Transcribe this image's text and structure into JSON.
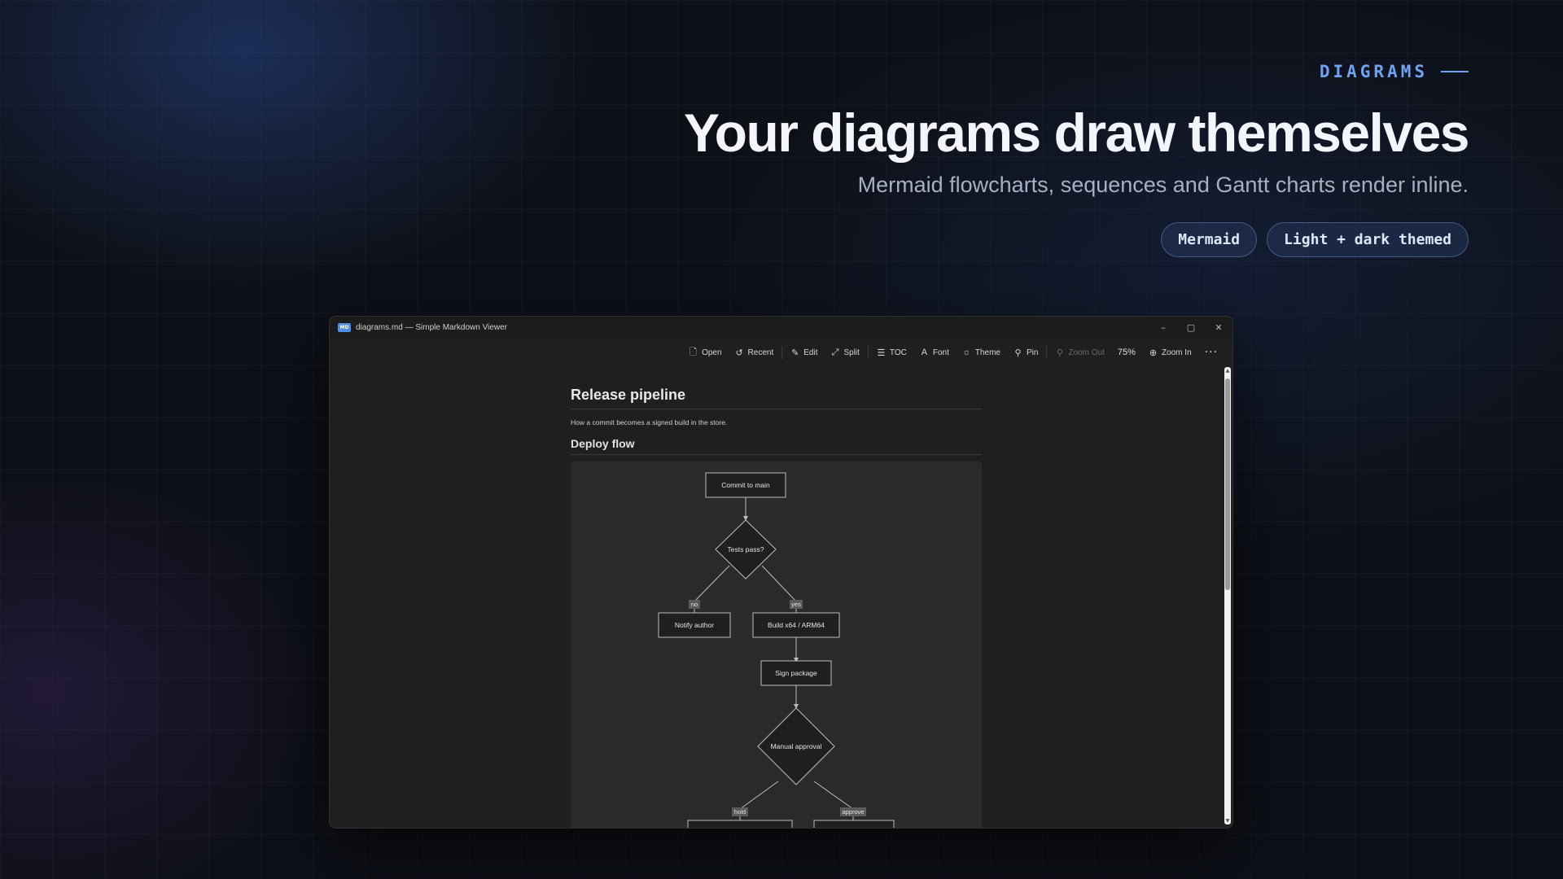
{
  "hero": {
    "eyebrow": "DIAGRAMS",
    "headline": "Your diagrams draw themselves",
    "subline": "Mermaid flowcharts, sequences and Gantt charts render inline.",
    "chips": [
      "Mermaid",
      "Light + dark themed"
    ]
  },
  "window": {
    "icon_label": "MD",
    "title": "diagrams.md — Simple Markdown Viewer",
    "controls": {
      "minimize": "–",
      "maximize": "▢",
      "close": "✕"
    }
  },
  "toolbar": {
    "open": "Open",
    "recent": "Recent",
    "edit": "Edit",
    "split": "Split",
    "toc": "TOC",
    "font": "Font",
    "theme": "Theme",
    "pin": "Pin",
    "zoom_out": "Zoom Out",
    "zoom_level": "75%",
    "zoom_in": "Zoom In",
    "more": "···"
  },
  "document": {
    "title": "Release pipeline",
    "intro": "How a commit becomes a signed build in the store.",
    "section": "Deploy flow"
  },
  "flowchart": {
    "nodes": {
      "commit": "Commit to main",
      "tests": "Tests pass?",
      "notify": "Notify author",
      "build": "Build x64 / ARM64",
      "sign": "Sign package",
      "approval": "Manual approval"
    },
    "edges": {
      "no": "no",
      "yes": "yes",
      "hold": "hold",
      "approve": "approve"
    }
  },
  "colors": {
    "accent": "#6fa3f2",
    "background": "#0d1017",
    "window": "#1f1f1f",
    "diagram_bg": "#2a2a2a"
  }
}
